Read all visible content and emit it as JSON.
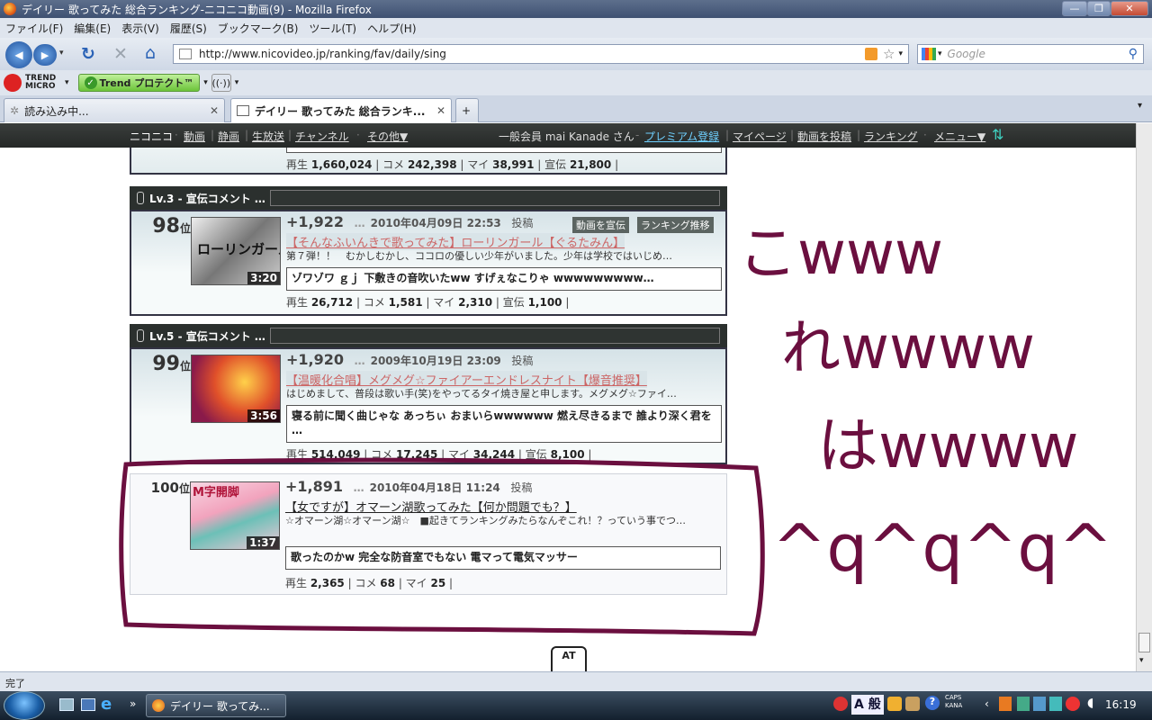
{
  "window": {
    "title": "デイリー 歌ってみた 総合ランキング-ニコニコ動画(9) - Mozilla Firefox"
  },
  "menu": [
    "ファイル(F)",
    "編集(E)",
    "表示(V)",
    "履歴(S)",
    "ブックマーク(B)",
    "ツール(T)",
    "ヘルプ(H)"
  ],
  "toolbar": {
    "url": "http://www.nicovideo.jp/ranking/fav/daily/sing",
    "search_placeholder": "Google"
  },
  "toolbar2": {
    "trend_logo": "TREND MICRO",
    "trend_button": "Trend プロテクト™"
  },
  "tabs": [
    {
      "label": "読み込み中..."
    },
    {
      "label": "デイリー 歌ってみた 総合ランキ..."
    }
  ],
  "nico_nav": {
    "left": [
      "ニコニコ",
      "動画",
      "静画",
      "生放送",
      "チャンネル",
      "その他▼"
    ],
    "user": "一般会員 mai Kanade さん",
    "premium": "プレミアム登録",
    "right": [
      "マイページ",
      "動画を投稿",
      "ランキング",
      "メニュー▼"
    ]
  },
  "prev_stats": {
    "play_label": "再生",
    "play": "1,660,024",
    "comment_label": "コメ",
    "comment": "242,398",
    "mylist_label": "マイ",
    "mylist": "38,991",
    "ad_label": "宣伝",
    "ad": "21,800"
  },
  "entries": [
    {
      "level": "Lv.3 - 宣伝コメント …",
      "rank_num": "98",
      "rank_suffix": "位",
      "duration": "3:20",
      "thumb_text": "ローリンガール",
      "points": "+1,922",
      "dots": "…",
      "date": "2010年04月09日 22:53",
      "post": "投稿",
      "btn_ad": "動画を宣伝",
      "btn_rec": "ランキング推移",
      "title": "【そんなふいんきで歌ってみた】ローリンガール【ぐるたみん】",
      "desc": "第７弾！！　むかしむかし、ココロの優しい少年がいました。少年は学校ではいじめ…",
      "comment": "ゾワゾワ ｇｊ 下敷きの音吹いたww すげぇなこりゃ wwwwwwwww…",
      "stats": {
        "play": "26,712",
        "comment": "1,581",
        "mylist": "2,310",
        "ad": "1,100"
      }
    },
    {
      "level": "Lv.5 - 宣伝コメント …",
      "rank_num": "99",
      "rank_suffix": "位",
      "duration": "3:56",
      "points": "+1,920",
      "dots": "…",
      "date": "2009年10月19日 23:09",
      "post": "投稿",
      "title": "【温暖化合唱】メグメグ☆ファイアーエンドレスナイト【爆音推奨】",
      "desc": "はじめまして、普段は歌い手(笑)をやってるタイ焼き屋と申します。メグメグ☆ファイ…",
      "comment": "寝る前に聞く曲じゃな あっちぃ おまいらwwwwww 燃え尽きるまで 誰より深く君を …",
      "stats": {
        "play": "514,049",
        "comment": "17,245",
        "mylist": "34,244",
        "ad": "8,100"
      }
    },
    {
      "rank_num": "100",
      "rank_suffix": "位",
      "duration": "1:37",
      "thumb_text": "M字開脚",
      "points": "+1,891",
      "dots": "…",
      "date": "2010年04月18日 11:24",
      "post": "投稿",
      "title": "【女ですが】オマーン湖歌ってみた【何か問題でも？】",
      "desc": "☆オマーン湖☆オマーン湖☆　■起きてランキングみたらなんぞこれ！？っていう事でつ…",
      "comment": "歌ったのかw 完全な防音室でもない 電マって電気マッサー",
      "stats": {
        "play": "2,365",
        "comment": "68",
        "mylist": "25"
      }
    }
  ],
  "handwriting": [
    "こwww",
    "れwwww",
    "はwwww",
    "^q^q^q^"
  ],
  "at_mascot": "AT",
  "status": "完了",
  "taskbar": {
    "task": "デイリー 歌ってみ...",
    "ime": "A 般",
    "caps": "CAPS",
    "kana": "KANA",
    "clock": "16:19"
  },
  "colors": {
    "ink": "#6b0f3f",
    "nicobar": "#2b2f2e",
    "titlebar": "#3f5172"
  }
}
